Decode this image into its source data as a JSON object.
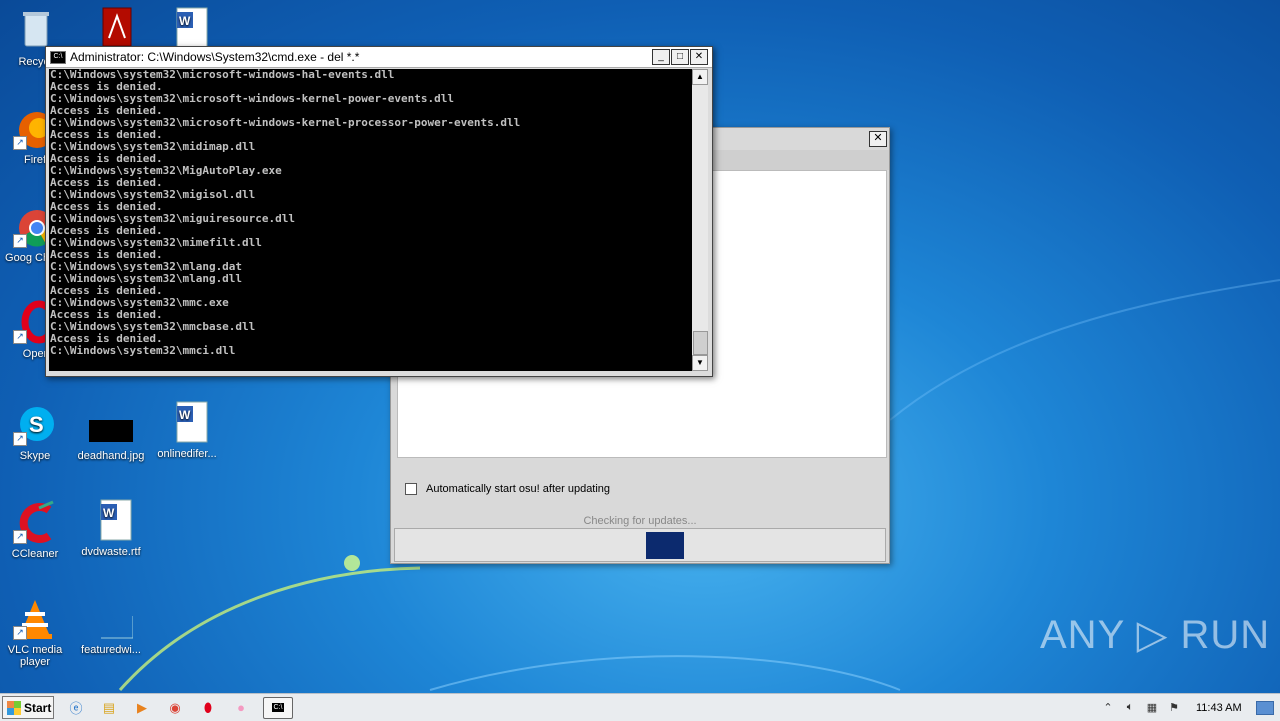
{
  "desktop": {
    "icons": [
      {
        "label": "Recycl"
      },
      {
        "label": "Firef"
      },
      {
        "label": "Goog Chron"
      },
      {
        "label": "Oper"
      },
      {
        "label": "Skype"
      },
      {
        "label": "deadhand.jpg"
      },
      {
        "label": "onlinedifer..."
      },
      {
        "label": "CCleaner"
      },
      {
        "label": "dvdwaste.rtf"
      },
      {
        "label": "VLC media player"
      },
      {
        "label": "featuredwi..."
      }
    ]
  },
  "cmd": {
    "title": "Administrator: C:\\Windows\\System32\\cmd.exe - del  *.*",
    "lines": [
      "C:\\Windows\\system32\\microsoft-windows-hal-events.dll",
      "Access is denied.",
      "C:\\Windows\\system32\\microsoft-windows-kernel-power-events.dll",
      "Access is denied.",
      "C:\\Windows\\system32\\microsoft-windows-kernel-processor-power-events.dll",
      "Access is denied.",
      "C:\\Windows\\system32\\midimap.dll",
      "Access is denied.",
      "C:\\Windows\\system32\\MigAutoPlay.exe",
      "Access is denied.",
      "C:\\Windows\\system32\\migisol.dll",
      "Access is denied.",
      "C:\\Windows\\system32\\miguiresource.dll",
      "Access is denied.",
      "C:\\Windows\\system32\\mimefilt.dll",
      "Access is denied.",
      "C:\\Windows\\system32\\mlang.dat",
      "C:\\Windows\\system32\\mlang.dll",
      "Access is denied.",
      "C:\\Windows\\system32\\mmc.exe",
      "Access is denied.",
      "C:\\Windows\\system32\\mmcbase.dll",
      "Access is denied.",
      "C:\\Windows\\system32\\mmci.dll"
    ],
    "minimize": "_",
    "maximize": "□",
    "close": "✕"
  },
  "updater": {
    "close": "✕",
    "auto_start_label": "Automatically start osu! after updating",
    "status": "Checking for updates...",
    "progress": 0.08
  },
  "watermark": "ANY ▷ RUN",
  "taskbar": {
    "start_label": "Start",
    "clock": "11:43 AM"
  }
}
